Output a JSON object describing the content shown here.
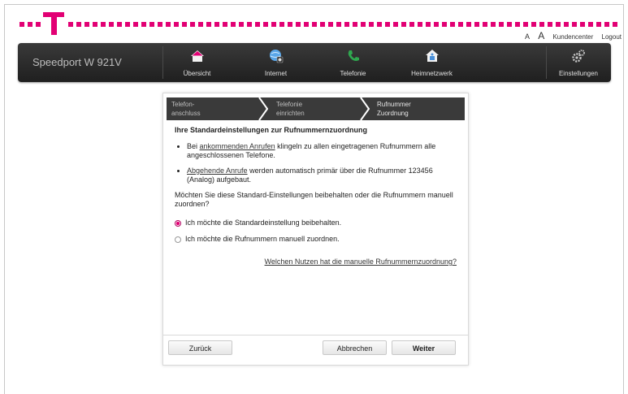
{
  "header": {
    "links": {
      "a_small": "A",
      "a_large": "A",
      "kundencenter": "Kundencenter",
      "logout": "Logout"
    },
    "brand_color": "#e20074"
  },
  "nav": {
    "device_name": "Speedport W 921V",
    "items": [
      {
        "label": "Übersicht",
        "icon": "home-icon"
      },
      {
        "label": "Internet",
        "icon": "globe-icon"
      },
      {
        "label": "Telefonie",
        "icon": "phone-icon"
      },
      {
        "label": "Heimnetzwerk",
        "icon": "home-network-icon"
      },
      {
        "label": "Einstellungen",
        "icon": "gear-icon"
      }
    ]
  },
  "wizard": {
    "steps": [
      {
        "line1": "Telefon-",
        "line2": "anschluss"
      },
      {
        "line1": "Telefonie",
        "line2": "einrichten"
      },
      {
        "line1": "Rufnummer",
        "line2": "Zuordnung"
      }
    ],
    "heading": "Ihre Standardeinstellungen zur Rufnummernzuordnung",
    "bullet1": {
      "link": "ankommenden Anrufen",
      "prefix": "Bei ",
      "text": " klingeln zu allen eingetragenen Rufnummern alle angeschlossenen Telefone."
    },
    "bullet2": {
      "link": "Abgehende Anrufe",
      "text": " werden automatisch primär über die Rufnummer 123456 (Analog) aufgebaut."
    },
    "question": "Möchten Sie diese Standard-Einstellungen beibehalten oder die Rufnummern manuell zuordnen?",
    "option_keep": "Ich möchte die Standardeinstellung beibehalten.",
    "option_manual": "Ich möchte die Rufnummern manuell zuordnen.",
    "help_link": "Welchen Nutzen hat die manuelle Rufnummernzuordnung?",
    "buttons": {
      "back": "Zurück",
      "cancel": "Abbrechen",
      "next": "Weiter"
    }
  }
}
